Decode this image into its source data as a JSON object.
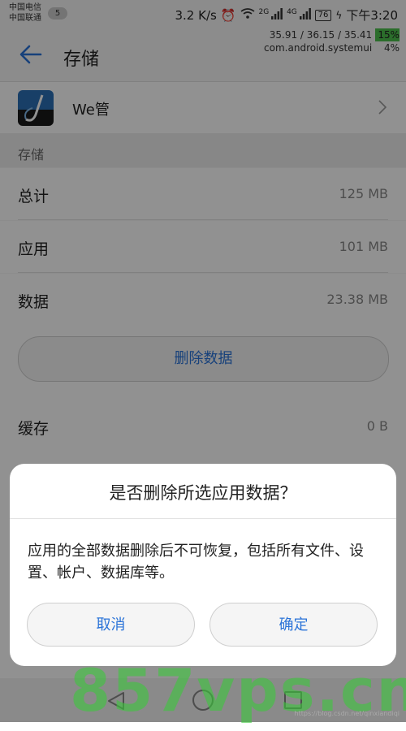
{
  "status_bar": {
    "carrier_1": "中国电信",
    "carrier_2": "中国联通",
    "sim_badge": "5",
    "net_speed": "3.2 K/s",
    "signal_1_label": "2G",
    "signal_2_label": "4G",
    "battery": "76",
    "time": "下午3:20"
  },
  "overlay": {
    "line1": "35.91 / 36.15 / 35.41",
    "line1_pct": "15%",
    "line2": "com.android.systemui",
    "line2_pct": "4%"
  },
  "appbar": {
    "title": "存储",
    "back_icon": "arrow-left-icon"
  },
  "app": {
    "name": "We管"
  },
  "section": {
    "title": "存储"
  },
  "rows": [
    {
      "label": "总计",
      "value": "125 MB"
    },
    {
      "label": "应用",
      "value": "101 MB"
    },
    {
      "label": "数据",
      "value": "23.38 MB"
    }
  ],
  "clear_data_button": "删除数据",
  "cache": {
    "label": "缓存",
    "value": "0 B"
  },
  "dialog": {
    "title": "是否删除所选应用数据？",
    "message": "应用的全部数据删除后不可恢复，包括所有文件、设置、帐户、数据库等。",
    "cancel": "取消",
    "ok": "确定"
  },
  "watermark": "857vps.cn",
  "credit": "https://blog.csdn.net/qinxiandiqi",
  "colors": {
    "accent": "#2a73d8",
    "scrim": "rgba(0,0,0,0.43)",
    "overlay_high": "#4cc04c"
  }
}
